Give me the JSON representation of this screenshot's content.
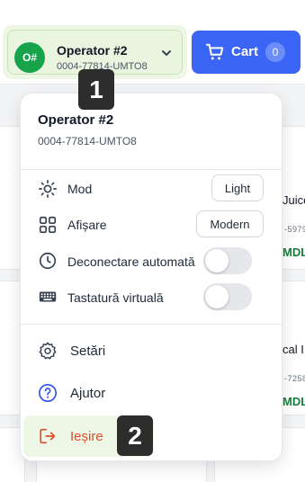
{
  "operator": {
    "initials": "O#",
    "name": "Operator #2",
    "id": "0004-77814-UMTO8"
  },
  "cart": {
    "label": "Cart",
    "count": "0"
  },
  "background": {
    "product1_title_fragment": "Juice",
    "product1_code_fragment": "-5979",
    "product1_price_fragment": "MDL",
    "product2_title_fragment": "cal I",
    "product2_code_fragment": "-7258",
    "product2_price_fragment": "MDL"
  },
  "menu": {
    "name": "Operator #2",
    "id": "0004-77814-UMTO8",
    "settings": [
      {
        "label": "Mod",
        "value": "Light",
        "icon": "sun-icon"
      },
      {
        "label": "Afișare",
        "value": "Modern",
        "icon": "grid-icon"
      },
      {
        "label": "Deconectare automată",
        "toggle": false,
        "icon": "clock-icon"
      },
      {
        "label": "Tastatură virtuală",
        "toggle": false,
        "icon": "keyboard-icon"
      }
    ],
    "actions": [
      {
        "label": "Setări",
        "icon": "gear-icon"
      },
      {
        "label": "Ajutor",
        "icon": "help-icon"
      },
      {
        "label": "Ieșire",
        "icon": "logout-icon"
      }
    ]
  },
  "badges": [
    "1",
    "2"
  ],
  "colors": {
    "accent_blue": "#3b66f5",
    "brand_green": "#16a34a",
    "logout_red": "#dc4d2d",
    "help_blue": "#2f54eb"
  }
}
